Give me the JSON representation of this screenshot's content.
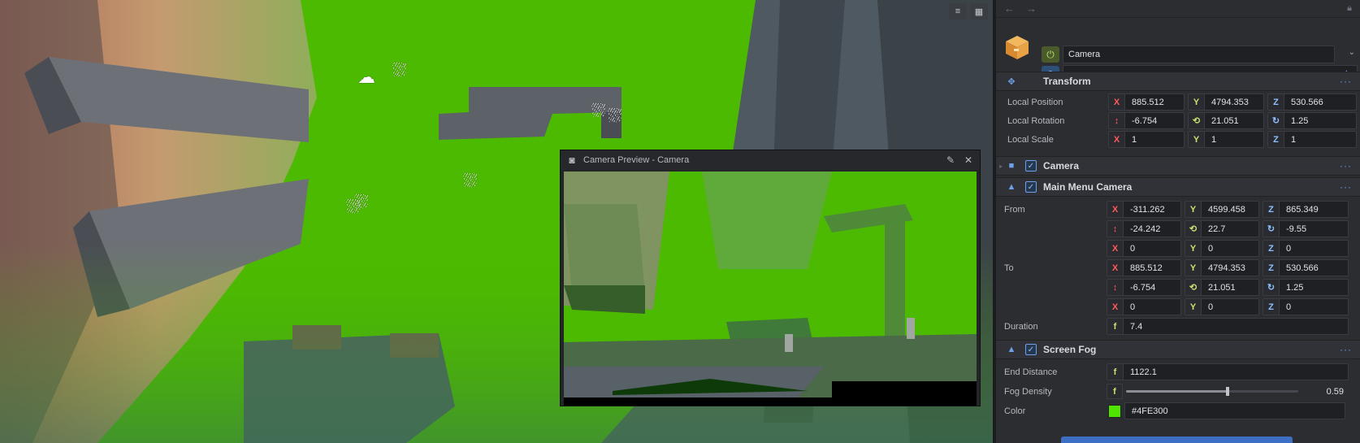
{
  "viewport": {
    "toolbar": [
      {
        "icon": "sliders-icon"
      },
      {
        "icon": "grid-icon"
      }
    ],
    "sky_color": "#4FE300"
  },
  "preview": {
    "title": "Camera Preview - Camera",
    "edit_icon": "✎",
    "close_icon": "✕"
  },
  "inspector": {
    "entity_name": "Camera",
    "transform": {
      "title": "Transform",
      "position_label": "Local Position",
      "rotation_label": "Local Rotation",
      "scale_label": "Local Scale",
      "position": {
        "x": "885.512",
        "y": "4794.353",
        "z": "530.566"
      },
      "rotation": {
        "x": "-6.754",
        "y": "21.051",
        "z": "1.25"
      },
      "scale": {
        "x": "1",
        "y": "1",
        "z": "1"
      }
    },
    "camera": {
      "title": "Camera",
      "enabled": true
    },
    "main_menu_camera": {
      "title": "Main Menu Camera",
      "from_label": "From",
      "to_label": "To",
      "duration_label": "Duration",
      "from_pos": {
        "x": "-311.262",
        "y": "4599.458",
        "z": "865.349"
      },
      "from_rot": {
        "x": "-24.242",
        "y": "22.7",
        "z": "-9.55"
      },
      "from_extra": {
        "x": "0",
        "y": "0",
        "z": "0"
      },
      "to_pos": {
        "x": "885.512",
        "y": "4794.353",
        "z": "530.566"
      },
      "to_rot": {
        "x": "-6.754",
        "y": "21.051",
        "z": "1.25"
      },
      "to_extra": {
        "x": "0",
        "y": "0",
        "z": "0"
      },
      "duration": "7.4"
    },
    "screen_fog": {
      "title": "Screen Fog",
      "end_distance_label": "End Distance",
      "fog_density_label": "Fog Density",
      "color_label": "Color",
      "end_distance": "1122.1",
      "fog_density": "0.59",
      "fog_density_fraction": 0.59,
      "color_hex": "#4FE300",
      "color": "#4fe300"
    },
    "axis": {
      "x": "X",
      "y": "Y",
      "z": "Z",
      "f": "f"
    },
    "menu_dots": "···"
  }
}
